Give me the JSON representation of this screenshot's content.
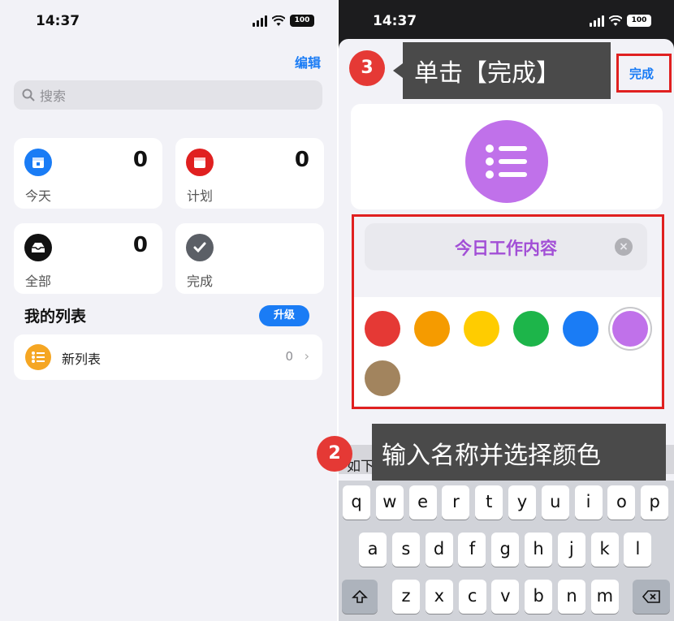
{
  "left": {
    "status": {
      "time": "14:37",
      "battery": "100"
    },
    "edit_label": "编辑",
    "search_placeholder": "搜索",
    "cards": [
      {
        "label": "今天",
        "count": "0",
        "color": "#1a7cf5",
        "icon": "calendar-today-icon"
      },
      {
        "label": "计划",
        "count": "0",
        "color": "#e02020",
        "icon": "calendar-scheduled-icon"
      },
      {
        "label": "全部",
        "count": "0",
        "color": "#111111",
        "icon": "tray-icon"
      },
      {
        "label": "完成",
        "count": "",
        "color": "#5b5f66",
        "icon": "checkmark-icon"
      }
    ],
    "my_lists_title": "我的列表",
    "upgrade_label": "升级",
    "list": {
      "name": "新列表",
      "count": "0",
      "color": "#f5a623"
    }
  },
  "right": {
    "status": {
      "time": "14:37",
      "battery": "100"
    },
    "done_label": "完成",
    "callout_3": {
      "number": "3",
      "text": "单击【完成】"
    },
    "callout_2": {
      "number": "2",
      "text": "输入名称并选择颜色"
    },
    "list_name_value": "今日工作内容",
    "list_icon_color": "#c071ea",
    "colors": [
      "#e53935",
      "#f59b00",
      "#ffcc00",
      "#1db54a",
      "#1a7cf5",
      "#c071ea",
      "#a2845e"
    ],
    "selected_color_index": 5,
    "suggestion_hint": "如下",
    "keyboard": {
      "row1": [
        "q",
        "w",
        "e",
        "r",
        "t",
        "y",
        "u",
        "i",
        "o",
        "p"
      ],
      "row2": [
        "a",
        "s",
        "d",
        "f",
        "g",
        "h",
        "j",
        "k",
        "l"
      ],
      "row3": [
        "z",
        "x",
        "c",
        "v",
        "b",
        "n",
        "m"
      ]
    }
  }
}
